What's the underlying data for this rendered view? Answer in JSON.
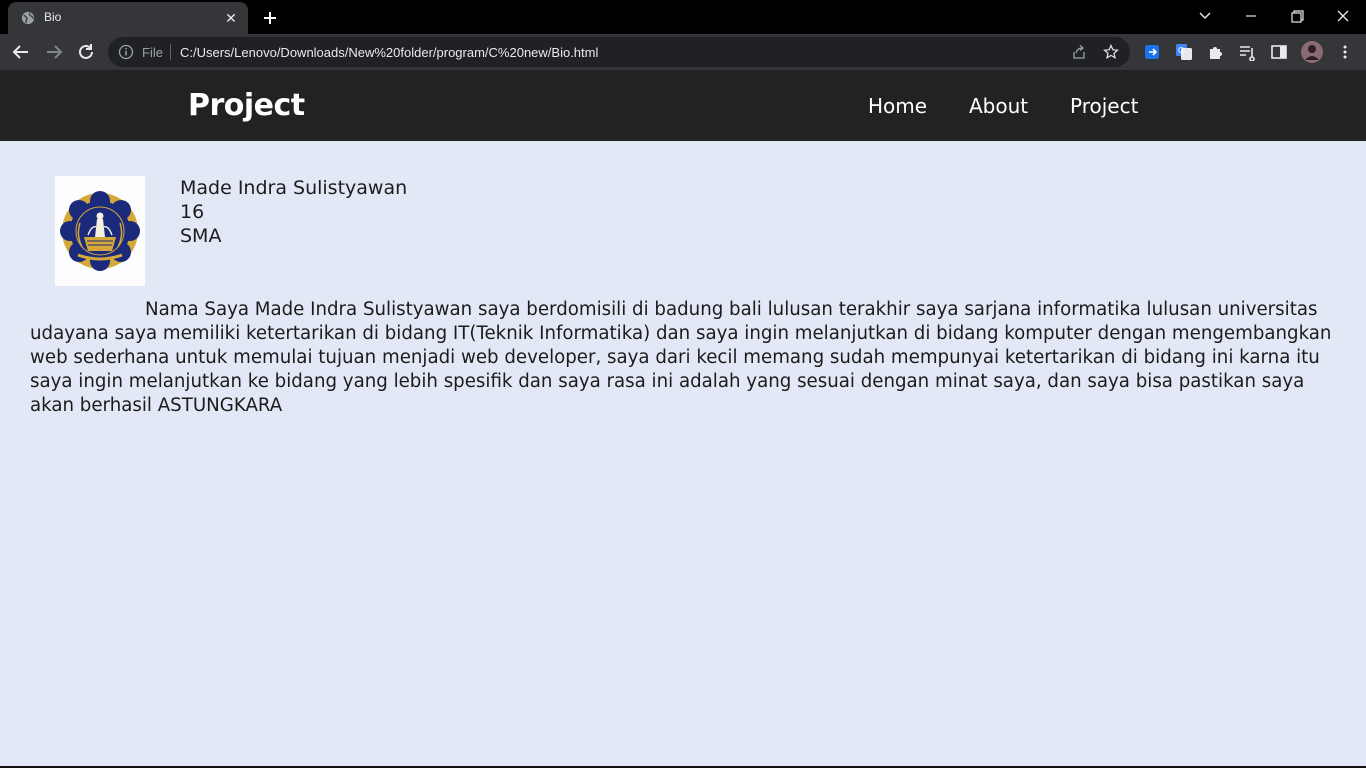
{
  "browser": {
    "tab_title": "Bio",
    "close_glyph": "✕",
    "file_label": "File",
    "url": "C:/Users/Lenovo/Downloads/New%20folder/program/C%20new/Bio.html"
  },
  "site": {
    "brand": "Project",
    "nav": [
      {
        "label": "Home"
      },
      {
        "label": "About"
      },
      {
        "label": "Project"
      }
    ]
  },
  "profile": {
    "name": "Made Indra Sulistyawan",
    "age": "16",
    "school": "SMA",
    "bio": "Nama Saya Made Indra Sulistyawan saya berdomisili di badung bali lulusan terakhir saya sarjana informatika lulusan universitas udayana saya memiliki ketertarikan di bidang IT(Teknik Informatika) dan saya ingin melanjutkan di bidang komputer dengan mengembangkan web sederhana untuk memulai tujuan menjadi web developer, saya dari kecil memang sudah mempunyai ketertarikan di bidang ini karna itu saya ingin melanjutkan ke bidang yang lebih spesifik dan saya rasa ini adalah yang sesuai dengan minat saya, dan saya bisa pastikan saya akan berhasil ASTUNGKARA"
  },
  "colors": {
    "header_bg": "#222222",
    "page_bg": "#e2e8f6",
    "text": "#1c1c1c",
    "logo_navy": "#1b2a7a",
    "logo_gold": "#d4a93a"
  }
}
